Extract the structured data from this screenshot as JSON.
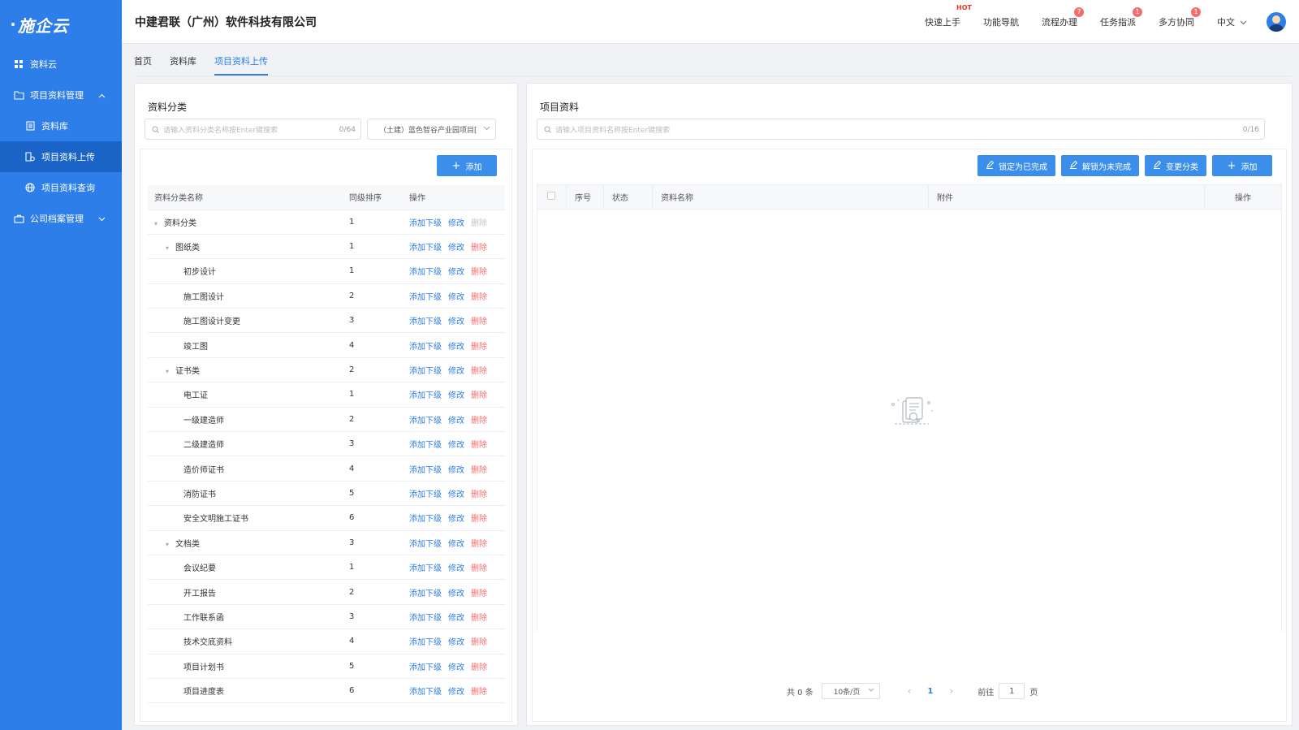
{
  "sidebar": {
    "logo": "施企云",
    "items": [
      {
        "label": "资料云"
      },
      {
        "label": "项目资料管理"
      },
      {
        "label": "资料库"
      },
      {
        "label": "项目资料上传"
      },
      {
        "label": "项目资料查询"
      },
      {
        "label": "公司档案管理"
      }
    ]
  },
  "header": {
    "company": "中建君联（广州）软件科技有限公司",
    "links": [
      {
        "label": "快速上手",
        "tag": "HOT"
      },
      {
        "label": "功能导航"
      },
      {
        "label": "流程办理",
        "badge": "7"
      },
      {
        "label": "任务指派",
        "badge": "1"
      },
      {
        "label": "多方协同",
        "badge": "1"
      }
    ],
    "lang": "中文"
  },
  "tabs": [
    "首页",
    "资料库",
    "项目资料上传"
  ],
  "left": {
    "title": "资料分类",
    "search_placeholder": "请输入资料分类名称按Enter键搜索",
    "search_count": "0/64",
    "project_select": "（土建）蓝色智谷产业园项目[",
    "add_label": "添加",
    "columns": [
      "资料分类名称",
      "同级排序",
      "操作"
    ],
    "op_add_child": "添加下级",
    "op_edit": "修改",
    "op_delete": "删除",
    "rows": [
      {
        "name": "资料分类",
        "order": "1",
        "level": 0,
        "expanded": true,
        "delete_disabled": true
      },
      {
        "name": "图纸类",
        "order": "1",
        "level": 1,
        "expanded": true
      },
      {
        "name": "初步设计",
        "order": "1",
        "level": 2
      },
      {
        "name": "施工图设计",
        "order": "2",
        "level": 2
      },
      {
        "name": "施工图设计变更",
        "order": "3",
        "level": 2
      },
      {
        "name": "竣工图",
        "order": "4",
        "level": 2
      },
      {
        "name": "证书类",
        "order": "2",
        "level": 1,
        "expanded": true
      },
      {
        "name": "电工证",
        "order": "1",
        "level": 2
      },
      {
        "name": "一级建造师",
        "order": "2",
        "level": 2
      },
      {
        "name": "二级建造师",
        "order": "3",
        "level": 2
      },
      {
        "name": "造价师证书",
        "order": "4",
        "level": 2
      },
      {
        "name": "消防证书",
        "order": "5",
        "level": 2
      },
      {
        "name": "安全文明施工证书",
        "order": "6",
        "level": 2
      },
      {
        "name": "文档类",
        "order": "3",
        "level": 1,
        "expanded": true
      },
      {
        "name": "会议纪要",
        "order": "1",
        "level": 2
      },
      {
        "name": "开工报告",
        "order": "2",
        "level": 2
      },
      {
        "name": "工作联系函",
        "order": "3",
        "level": 2
      },
      {
        "name": "技术交底资料",
        "order": "4",
        "level": 2
      },
      {
        "name": "项目计划书",
        "order": "5",
        "level": 2
      },
      {
        "name": "项目进度表",
        "order": "6",
        "level": 2
      }
    ]
  },
  "right": {
    "title": "项目资料",
    "search_placeholder": "请输入项目资料名称按Enter键搜索",
    "search_count": "0/16",
    "buttons": {
      "lock": "锁定为已完成",
      "unlock": "解锁为未完成",
      "change": "变更分类",
      "add": "添加"
    },
    "columns": [
      "序号",
      "状态",
      "资料名称",
      "附件",
      "操作"
    ],
    "pager": {
      "total": "共 0 条",
      "size": "10条/页",
      "current": "1",
      "goto_prefix": "前往",
      "goto_value": "1",
      "goto_suffix": "页"
    }
  }
}
